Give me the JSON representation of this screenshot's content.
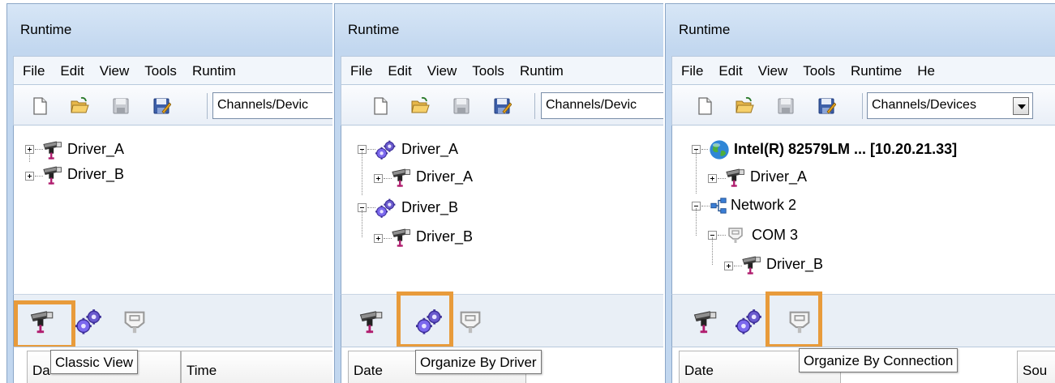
{
  "colors": {
    "highlight": "#e89b3b",
    "titlebar": "#c2d7ef",
    "tree_bg": "#ffffff"
  },
  "panels": [
    {
      "title": "Runtime",
      "menu": [
        "File",
        "Edit",
        "View",
        "Tools",
        "Runtim"
      ],
      "combo": "Channels/Devic",
      "tree": [
        {
          "label": "Driver_A",
          "icon": "driver-icon"
        },
        {
          "label": "Driver_B",
          "icon": "driver-icon"
        }
      ],
      "view_buttons": [
        "classic-view-icon",
        "organize-by-driver-icon",
        "organize-by-connection-icon"
      ],
      "columns": [
        "Da",
        "Time"
      ],
      "tooltip": "Classic View"
    },
    {
      "title": "Runtime",
      "menu": [
        "File",
        "Edit",
        "View",
        "Tools",
        "Runtim"
      ],
      "combo": "Channels/Devic",
      "tree": [
        {
          "label": "Driver_A",
          "icon": "gears-icon"
        },
        {
          "label": "Driver_A",
          "icon": "driver-icon"
        },
        {
          "label": "Driver_B",
          "icon": "gears-icon"
        },
        {
          "label": "Driver_B",
          "icon": "driver-icon"
        }
      ],
      "columns": [
        "Date"
      ],
      "tooltip": "Organize By Driver"
    },
    {
      "title": "Runtime",
      "menu": [
        "File",
        "Edit",
        "View",
        "Tools",
        "Runtime",
        "He"
      ],
      "combo": "Channels/Devices",
      "tree": [
        {
          "label": "Intel(R) 82579LM ... [10.20.21.33]",
          "icon": "globe-network-icon"
        },
        {
          "label": "Driver_A",
          "icon": "driver-icon"
        },
        {
          "label": "Network 2",
          "icon": "network-icon"
        },
        {
          "label": "COM 3",
          "icon": "serial-port-icon"
        },
        {
          "label": "Driver_B",
          "icon": "driver-icon"
        }
      ],
      "columns": [
        "Date",
        "Sou"
      ],
      "tooltip": "Organize By Connection"
    }
  ]
}
